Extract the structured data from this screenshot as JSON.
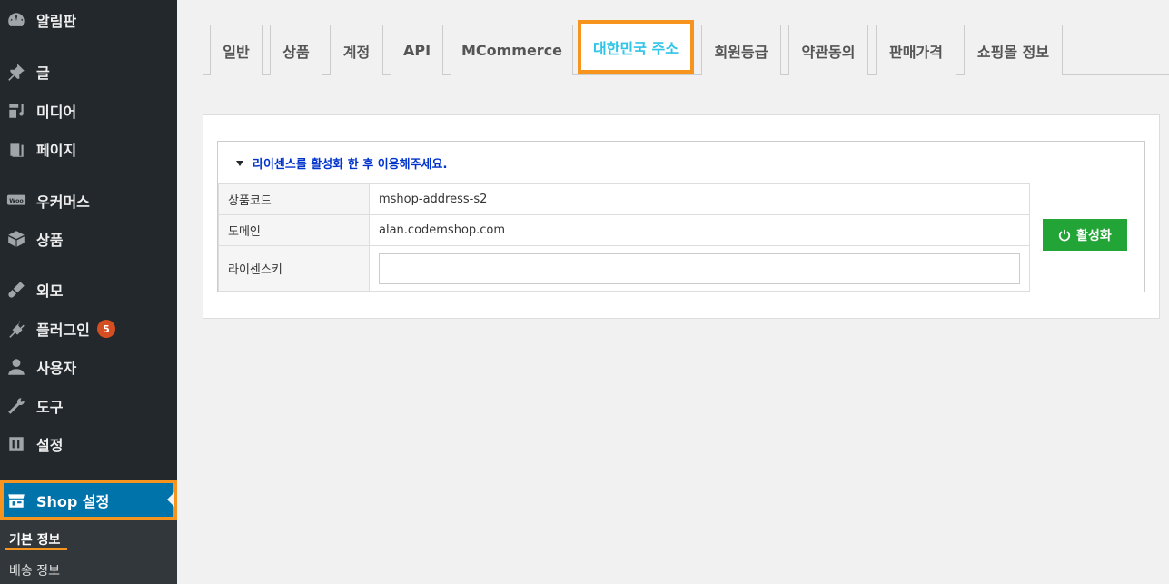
{
  "sidebar": {
    "items": [
      {
        "label": "알림판",
        "icon": "dashboard-icon"
      },
      {
        "label": "글",
        "icon": "pin-icon"
      },
      {
        "label": "미디어",
        "icon": "media-icon"
      },
      {
        "label": "페이지",
        "icon": "page-icon"
      },
      {
        "label": "우커머스",
        "icon": "woo-icon"
      },
      {
        "label": "상품",
        "icon": "box-icon"
      },
      {
        "label": "외모",
        "icon": "brush-icon"
      },
      {
        "label": "플러그인",
        "icon": "plugin-icon",
        "badge": "5"
      },
      {
        "label": "사용자",
        "icon": "user-icon"
      },
      {
        "label": "도구",
        "icon": "wrench-icon"
      },
      {
        "label": "설정",
        "icon": "settings-icon"
      }
    ],
    "shop": {
      "label": "Shop 설정",
      "icon": "shop-icon"
    },
    "submenu": [
      {
        "label": "기본 정보"
      },
      {
        "label": "배송 정보"
      }
    ]
  },
  "tabs": [
    {
      "label": "일반"
    },
    {
      "label": "상품"
    },
    {
      "label": "계정"
    },
    {
      "label": "API"
    },
    {
      "label": "MCommerce"
    },
    {
      "label": "대한민국 주소"
    },
    {
      "label": "회원등급"
    },
    {
      "label": "약관동의"
    },
    {
      "label": "판매가격"
    },
    {
      "label": "쇼핑몰 정보"
    }
  ],
  "license": {
    "notice": "라이센스를 활성화 한 후 이용해주세요.",
    "rows": [
      {
        "label": "상품코드",
        "value": "mshop-address-s2"
      },
      {
        "label": "도메인",
        "value": "alan.codemshop.com"
      },
      {
        "label": "라이센스키",
        "value": ""
      }
    ],
    "activate_label": "활성화"
  },
  "colors": {
    "sidebar_bg": "#23282d",
    "active_menu": "#0073aa",
    "highlight": "#f7941d",
    "active_tab_text": "#2fc4e8",
    "activate_button": "#22a536",
    "badge": "#d54e21"
  }
}
